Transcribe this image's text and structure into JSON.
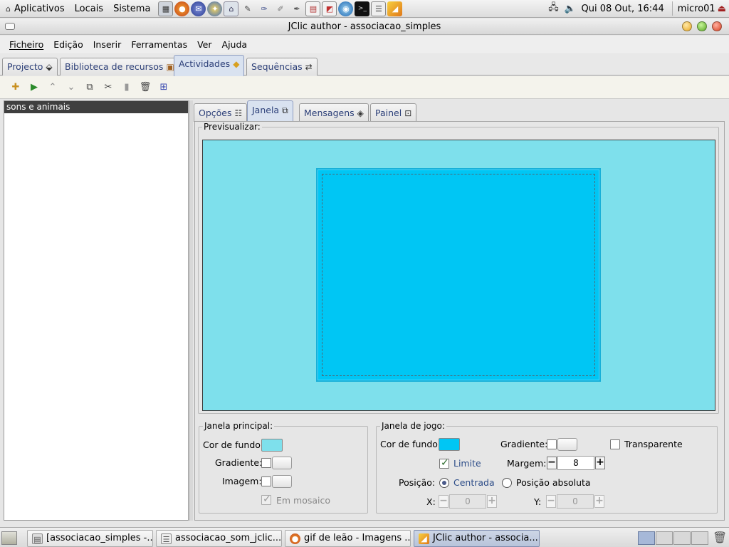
{
  "top_panel": {
    "menus": [
      "Aplicativos",
      "Locais",
      "Sistema"
    ],
    "launchers": [
      "calculator-icon",
      "firefox-icon",
      "thunderbird-icon",
      "evolution-icon",
      "network-icon",
      "pen-icon",
      "paint-icon",
      "brush-icon",
      "editor-icon",
      "spreadsheet-icon",
      "presentation-icon",
      "browser-icon",
      "terminal-icon",
      "text-editor-icon",
      "jclic-icon"
    ],
    "clock": "Qui 08 Out, 16:44",
    "user": "micro01"
  },
  "window": {
    "title": "JClic author - associacao_simples"
  },
  "menubar": [
    "Ficheiro",
    "Edição",
    "Inserir",
    "Ferramentas",
    "Ver",
    "Ajuda"
  ],
  "main_tabs": [
    {
      "label": "Projecto"
    },
    {
      "label": "Biblioteca de recursos"
    },
    {
      "label": "Actividades",
      "active": true
    },
    {
      "label": "Sequências"
    }
  ],
  "toolbar": [
    "new-activity-icon",
    "play-icon",
    "move-up-icon",
    "move-down-icon",
    "copy-icon",
    "cut-icon",
    "paste-icon",
    "delete-icon",
    "arrange-icon"
  ],
  "activities": [
    "sons e animais"
  ],
  "sub_tabs": [
    {
      "label": "Opções"
    },
    {
      "label": "Janela",
      "active": true
    },
    {
      "label": "Mensagens"
    },
    {
      "label": "Painel"
    }
  ],
  "preview": {
    "label": "Previsualizar:",
    "main_bg_color": "#7ee0ec",
    "game_bg_color": "#00c6f4"
  },
  "main_window": {
    "title": "Janela principal:",
    "bg_color_label": "Cor de fundo:",
    "gradient_label": "Gradiente:",
    "image_label": "Imagem:",
    "mosaic_label": "Em mosaico",
    "mosaic_checked": true
  },
  "game_window": {
    "title": "Janela de jogo:",
    "bg_color_label": "Cor de fundo:",
    "gradient_label": "Gradiente:",
    "transparent_label": "Transparente",
    "transparent_checked": false,
    "border_label": "Limite",
    "border_checked": true,
    "margin_label": "Margem:",
    "margin_value": "8",
    "position_label": "Posição:",
    "centered_label": "Centrada",
    "absolute_label": "Posição absoluta",
    "x_label": "X:",
    "x_value": "0",
    "y_label": "Y:",
    "y_value": "0"
  },
  "taskbar": [
    {
      "label": "[associacao_simples -...",
      "icon": "file-icon"
    },
    {
      "label": "associacao_som_jclic....",
      "icon": "document-icon"
    },
    {
      "label": "gif de leão - Imagens ...",
      "icon": "firefox-icon"
    },
    {
      "label": "JClic author - associa...",
      "icon": "jclic-icon",
      "active": true
    }
  ]
}
